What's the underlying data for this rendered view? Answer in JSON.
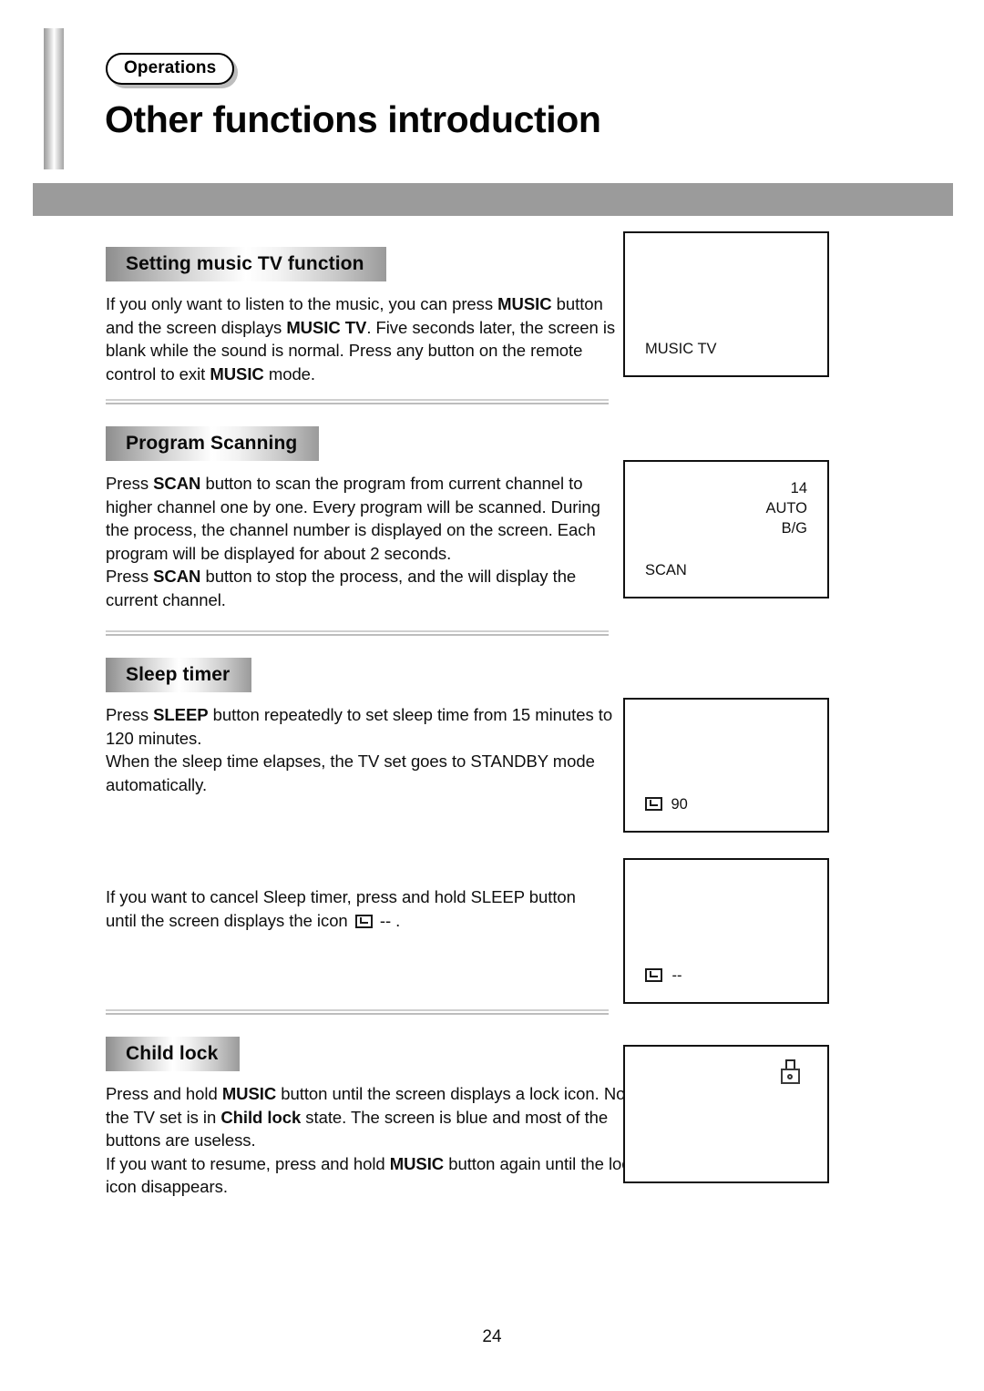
{
  "header": {
    "badge_label": "Operations",
    "title": "Other functions introduction",
    "band_color": "#9b9b9b"
  },
  "sections": [
    {
      "heading": "Setting music TV function",
      "paragraphs": [
        [
          {
            "t": "If you only want to listen to the music, you can press ",
            "b": false
          },
          {
            "t": "MUSIC",
            "b": true
          },
          {
            "t": " button and the screen displays ",
            "b": false
          },
          {
            "t": "MUSIC TV",
            "b": true
          },
          {
            "t": ". Five seconds later, the screen is blank while the sound is normal. Press any button on the remote control to exit ",
            "b": false
          },
          {
            "t": "MUSIC",
            "b": true
          },
          {
            "t": " mode.",
            "b": false
          }
        ]
      ],
      "screen": {
        "bottom_left": "MUSIC TV"
      }
    },
    {
      "heading": "Program Scanning",
      "paragraphs": [
        [
          {
            "t": "Press ",
            "b": false
          },
          {
            "t": "SCAN",
            "b": true
          },
          {
            "t": " button to scan the program from current channel to higher channel one by one. Every program will be scanned. During the process, the channel number is displayed on the screen. Each program will be displayed for about 2 seconds.",
            "b": false
          }
        ],
        [
          {
            "t": "Press ",
            "b": false
          },
          {
            "t": "SCAN",
            "b": true
          },
          {
            "t": " button to stop the process, and the will display the current channel.",
            "b": false
          }
        ]
      ],
      "screen": {
        "top_right": [
          "14",
          "AUTO",
          "B/G"
        ],
        "bottom_left": "SCAN"
      }
    },
    {
      "heading": "Sleep timer",
      "paragraphs": [
        [
          {
            "t": "Press ",
            "b": false
          },
          {
            "t": "SLEEP",
            "b": true
          },
          {
            "t": " button repeatedly to set sleep time from 15 minutes to 120 minutes.",
            "b": false
          }
        ],
        [
          {
            "t": "When the sleep time elapses, the TV set goes to STANDBY mode automatically.",
            "b": false
          }
        ]
      ],
      "screen": {
        "bottom_left_icon": "sleep-timer-icon",
        "bottom_left": "90"
      }
    },
    {
      "heading": "Child lock",
      "paragraphs": [
        [
          {
            "t": "Press and hold ",
            "b": false
          },
          {
            "t": "MUSIC",
            "b": true
          },
          {
            "t": " button until the screen displays a lock icon. Now the TV set is in ",
            "b": false
          },
          {
            "t": "Child lock",
            "b": true
          },
          {
            "t": " state. The screen is blue and most of the buttons are useless.",
            "b": false
          }
        ],
        [
          {
            "t": "If you want to resume, press and hold ",
            "b": false
          },
          {
            "t": "MUSIC",
            "b": true
          },
          {
            "t": " button again until the lock icon disappears.",
            "b": false
          }
        ]
      ],
      "screen": {
        "top_right_icon": "padlock-icon"
      }
    }
  ],
  "cancel_note": {
    "line1": "If you want to cancel Sleep timer, press and hold SLEEP button",
    "line2_before": "until the screen displays the icon",
    "line2_after": "-- ."
  },
  "cancel_screen": {
    "bottom_left_icon": "sleep-timer-icon",
    "bottom_left": "--"
  },
  "footer": {
    "page_number": "24"
  }
}
